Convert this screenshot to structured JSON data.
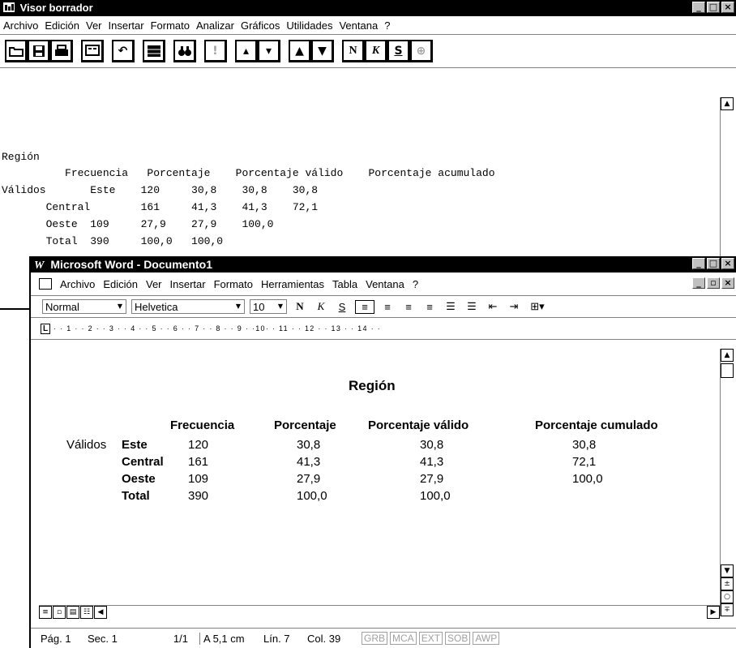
{
  "viewer": {
    "title": "Visor borrador",
    "menu": [
      "Archivo",
      "Edición",
      "Ver",
      "Insertar",
      "Formato",
      "Analizar",
      "Gráficos",
      "Utilidades",
      "Ventana",
      "?"
    ],
    "toolbar_icons": [
      "open-icon",
      "save-icon",
      "print-icon",
      "dialog-recall-icon",
      "undo-icon",
      "goto-chart-icon",
      "find-icon",
      "info-icon",
      "designate-up-icon",
      "designate-down-icon",
      "promote-icon",
      "demote-icon",
      "bold-icon",
      "italic-icon",
      "underline-icon",
      "globe-icon"
    ],
    "toolbar_glyphs": {
      "bold": "N",
      "italic": "K",
      "underline": "S"
    },
    "output": {
      "title": "Región",
      "header": "          Frecuencia   Porcentaje    Porcentaje válido    Porcentaje acumulado",
      "row1": "Válidos       Este    120     30,8    30,8    30,8",
      "row2": "       Central        161     41,3    41,3    72,1",
      "row3": "       Oeste  109     27,9    27,9    100,0",
      "row4": "       Total  390     100,0   100,0"
    }
  },
  "word": {
    "title": "Microsoft Word - Documento1",
    "menu": [
      "Archivo",
      "Edición",
      "Ver",
      "Insertar",
      "Formato",
      "Herramientas",
      "Tabla",
      "Ventana",
      "?"
    ],
    "style": "Normal",
    "font": "Helvetica",
    "size": "10",
    "format_glyphs": {
      "bold": "N",
      "italic": "K",
      "underline": "S"
    },
    "ruler": "· · 1 · · 2 · · 3 · · 4 · · 5 · · 6 · · 7 · · 8 · · 9 · ·10· · 11 · · 12 · · 13 · · 14 · ·",
    "doc": {
      "title": "Región",
      "headers": [
        "Frecuencia",
        "Porcentaje",
        "Porcentaje válido",
        "Porcentaje cumulado"
      ],
      "label": "Válidos",
      "rows": [
        {
          "name": "Este",
          "freq": "120",
          "pct": "30,8",
          "valid": "30,8",
          "cum": "30,8"
        },
        {
          "name": "Central",
          "freq": "161",
          "pct": "41,3",
          "valid": "41,3",
          "cum": "72,1"
        },
        {
          "name": "Oeste",
          "freq": "109",
          "pct": "27,9",
          "valid": "27,9",
          "cum": "100,0"
        },
        {
          "name": "Total",
          "freq": "390",
          "pct": "100,0",
          "valid": "100,0",
          "cum": ""
        }
      ]
    },
    "status": {
      "page": "Pág. 1",
      "section": "Sec. 1",
      "pages": "1/1",
      "at": "A 5,1 cm",
      "line": "Lín. 7",
      "col": "Col. 39",
      "modes": [
        "GRB",
        "MCA",
        "EXT",
        "SOB",
        "AWP"
      ]
    }
  }
}
